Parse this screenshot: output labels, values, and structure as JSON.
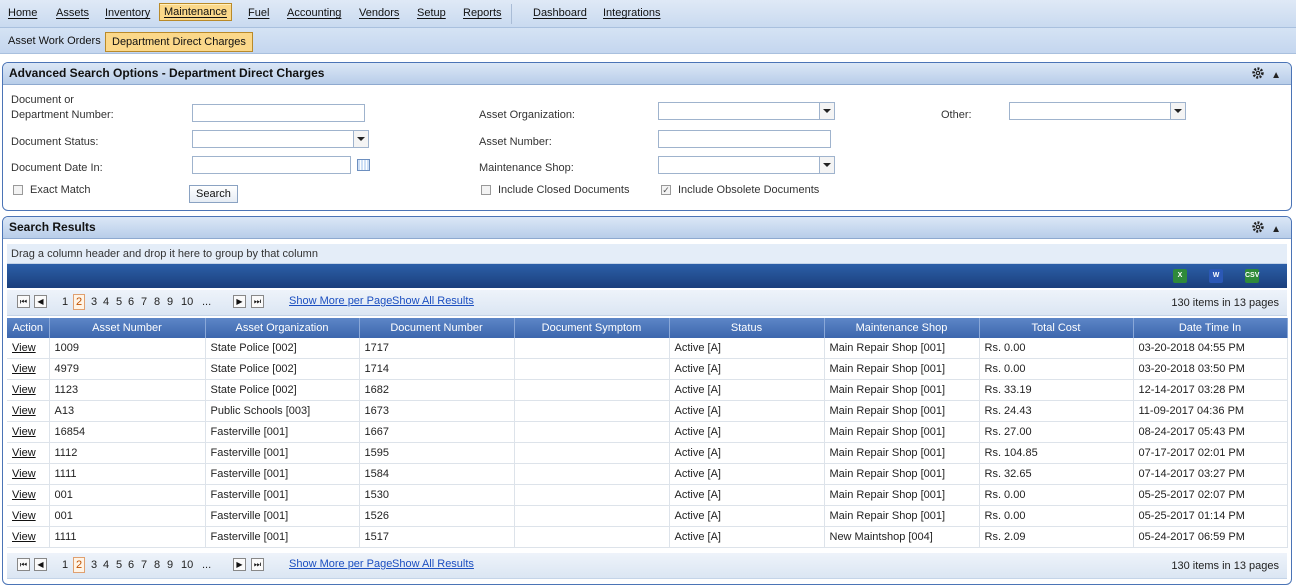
{
  "top_nav": [
    {
      "label": "Home",
      "active": false
    },
    {
      "label": "Assets",
      "active": false
    },
    {
      "label": "Inventory",
      "active": false
    },
    {
      "label": "Maintenance",
      "active": true
    },
    {
      "label": "Fuel",
      "active": false
    },
    {
      "label": "Accounting",
      "active": false
    },
    {
      "label": "Vendors",
      "active": false
    },
    {
      "label": "Setup",
      "active": false
    },
    {
      "label": "Reports",
      "active": false
    },
    {
      "label": "Dashboard",
      "active": false
    },
    {
      "label": "Integrations",
      "active": false
    }
  ],
  "sub_nav": [
    {
      "label": "Asset Work Orders",
      "active": false
    },
    {
      "label": "Department Direct Charges",
      "active": true
    }
  ],
  "search_panel": {
    "title": "Advanced Search Options - Department Direct Charges",
    "doc_number_label_1": "Document or",
    "doc_number_label_2": "Department Number:",
    "doc_status_label": "Document Status:",
    "doc_date_label": "Document Date In:",
    "exact_match_label": "Exact Match",
    "search_button": "Search",
    "asset_org_label": "Asset Organization:",
    "asset_number_label": "Asset Number:",
    "maint_shop_label": "Maintenance Shop:",
    "include_closed_label": "Include Closed Documents",
    "include_obsolete_label": "Include Obsolete Documents",
    "other_label": "Other:",
    "exact_match_checked": false,
    "include_closed_checked": false,
    "include_obsolete_checked": true
  },
  "results_panel": {
    "title": "Search Results",
    "group_hint": "Drag a column header and drop it here to group by that column",
    "export_icons": [
      "excel-export-icon",
      "word-export-icon",
      "csv-export-icon"
    ],
    "pager": {
      "pages": [
        "1",
        "2",
        "3",
        "4",
        "5",
        "6",
        "7",
        "8",
        "9",
        "10",
        "..."
      ],
      "current_page": "2",
      "show_more": "Show More per Page",
      "show_all": "Show All Results",
      "summary": "130 items in 13 pages"
    },
    "columns": [
      "Action",
      "Asset Number",
      "Asset Organization",
      "Document Number",
      "Document Symptom",
      "Status",
      "Maintenance Shop",
      "Total Cost",
      "Date Time In"
    ],
    "rows": [
      [
        "View",
        "1009",
        "State Police [002]",
        "1717",
        "",
        "Active [A]",
        "Main Repair Shop [001]",
        "Rs. 0.00",
        "03-20-2018 04:55 PM"
      ],
      [
        "View",
        "4979",
        "State Police [002]",
        "1714",
        "",
        "Active [A]",
        "Main Repair Shop [001]",
        "Rs. 0.00",
        "03-20-2018 03:50 PM"
      ],
      [
        "View",
        "1123",
        "State Police [002]",
        "1682",
        "",
        "Active [A]",
        "Main Repair Shop [001]",
        "Rs. 33.19",
        "12-14-2017 03:28 PM"
      ],
      [
        "View",
        "A13",
        "Public Schools [003]",
        "1673",
        "",
        "Active [A]",
        "Main Repair Shop [001]",
        "Rs. 24.43",
        "11-09-2017 04:36 PM"
      ],
      [
        "View",
        "16854",
        "Fasterville [001]",
        "1667",
        "",
        "Active [A]",
        "Main Repair Shop [001]",
        "Rs. 27.00",
        "08-24-2017 05:43 PM"
      ],
      [
        "View",
        "1112",
        "Fasterville [001]",
        "1595",
        "",
        "Active [A]",
        "Main Repair Shop [001]",
        "Rs. 104.85",
        "07-17-2017 02:01 PM"
      ],
      [
        "View",
        "1111",
        "Fasterville [001]",
        "1584",
        "",
        "Active [A]",
        "Main Repair Shop [001]",
        "Rs. 32.65",
        "07-14-2017 03:27 PM"
      ],
      [
        "View",
        "001",
        "Fasterville [001]",
        "1530",
        "",
        "Active [A]",
        "Main Repair Shop [001]",
        "Rs. 0.00",
        "05-25-2017 02:07 PM"
      ],
      [
        "View",
        "001",
        "Fasterville [001]",
        "1526",
        "",
        "Active [A]",
        "Main Repair Shop [001]",
        "Rs. 0.00",
        "05-25-2017 01:14 PM"
      ],
      [
        "View",
        "1111",
        "Fasterville [001]",
        "1517",
        "",
        "Active [A]",
        "New Maintshop [004]",
        "Rs. 2.09",
        "05-24-2017 06:59 PM"
      ]
    ]
  },
  "colors": {
    "accent": "#fbd88a",
    "header": "#3c66ad",
    "link": "#1c4fc0"
  }
}
